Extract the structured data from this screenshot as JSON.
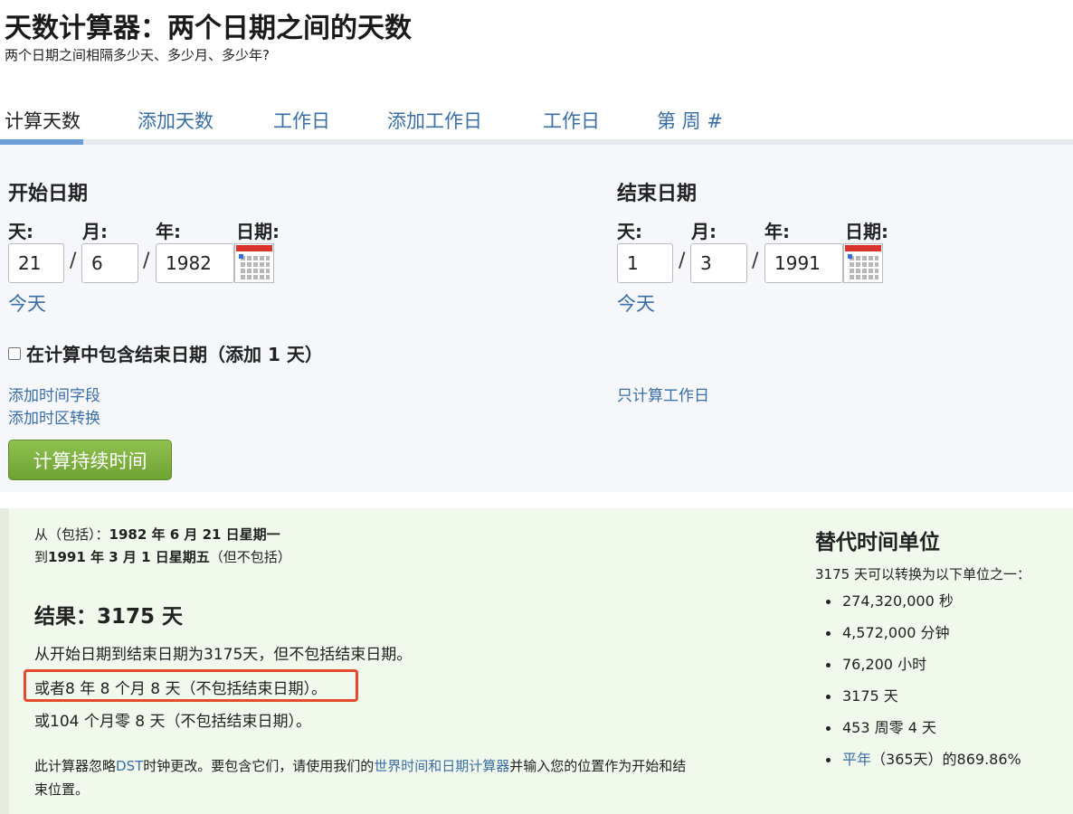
{
  "page": {
    "title": "天数计算器：两个日期之间的天数",
    "subtitle": "两个日期之间相隔多少天、多少月、多少年?"
  },
  "tabs": [
    {
      "label": "计算天数",
      "active": true
    },
    {
      "label": "添加天数"
    },
    {
      "label": "工作日"
    },
    {
      "label": "添加工作日"
    },
    {
      "label": "工作日"
    },
    {
      "label": "第 周 #"
    }
  ],
  "start": {
    "heading": "开始日期",
    "day_label": "天:",
    "month_label": "月:",
    "year_label": "年:",
    "date_label": "日期:",
    "day": "21",
    "month": "6",
    "year": "1982",
    "today": "今天"
  },
  "end": {
    "heading": "结束日期",
    "day_label": "天:",
    "month_label": "月:",
    "year_label": "年:",
    "date_label": "日期:",
    "day": "1",
    "month": "3",
    "year": "1991",
    "today": "今天"
  },
  "separator": "/",
  "options": {
    "include_end": "在计算中包含结束日期（添加 1 天）",
    "include_end_checked": false,
    "add_time": "添加时间字段",
    "add_tz": "添加时区转换",
    "workdays_only": "只计算工作日"
  },
  "calc_button": "计算持续时间",
  "result": {
    "from_prefix": "从（包括）：",
    "from_date": "1982 年 6 月 21 日星期一",
    "to_prefix": "到",
    "to_date": "1991 年 3 月 1 日星期五",
    "to_suffix": "（但不包括）",
    "heading": "结果：3175 天",
    "line1": "从开始日期到结束日期为3175天，但不包括结束日期。",
    "line2": "或者8 年 8 个月 8 天（不包括结束日期）。",
    "line3": "或104 个月零 8 天（不包括结束日期）。",
    "note_a": "此计算器忽略",
    "note_dst": "DST",
    "note_b": "时钟更改。要包含它们，请使用我们的",
    "note_link": "世界时间和日期计算器",
    "note_c": "并输入您的位置作为开始和结",
    "note_d": "束位置。"
  },
  "alt": {
    "heading": "替代时间单位",
    "intro": "3175 天可以转换为以下单位之一：",
    "items": [
      {
        "text": "274,320,000 秒"
      },
      {
        "text": "4,572,000 分钟"
      },
      {
        "text": "76,200 小时"
      },
      {
        "text": "3175 天"
      },
      {
        "text": "453 周零 4 天"
      },
      {
        "link": "平年",
        "text": "（365天）的869.86%"
      }
    ]
  },
  "colors": {
    "link": "#3a6ea5",
    "button": "#7bb13c",
    "highlight": "#e44a2c",
    "result_bg": "#f1f8ec",
    "form_bg": "#f5f7fa"
  }
}
